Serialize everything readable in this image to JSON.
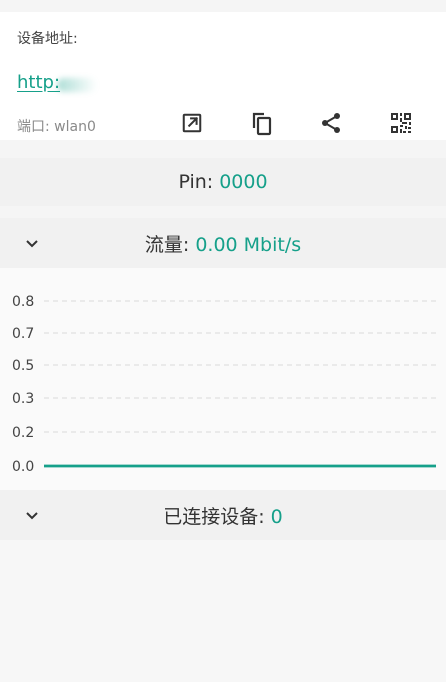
{
  "address": {
    "title": "设备地址:",
    "link": "http:",
    "port": "端口: wlan0"
  },
  "actions": [
    {
      "name": "open-external-icon"
    },
    {
      "name": "copy-icon"
    },
    {
      "name": "share-icon"
    },
    {
      "name": "qr-code-icon"
    }
  ],
  "pin": {
    "label": "Pin:",
    "value": "0000"
  },
  "flow": {
    "label": "流量: ",
    "value": "0.00 Mbit/s"
  },
  "connected": {
    "label": "已连接设备: ",
    "value": "0"
  },
  "colors": {
    "accent": "#16a08a",
    "grid": "#d9d9d9"
  },
  "chart_data": {
    "type": "line",
    "ytick_labels": [
      "0.8",
      "0.7",
      "0.5",
      "0.3",
      "0.2",
      "0.0"
    ],
    "ylim": [
      0,
      0.8
    ],
    "series": [
      {
        "values": [
          0,
          0
        ]
      }
    ],
    "grid": true
  }
}
